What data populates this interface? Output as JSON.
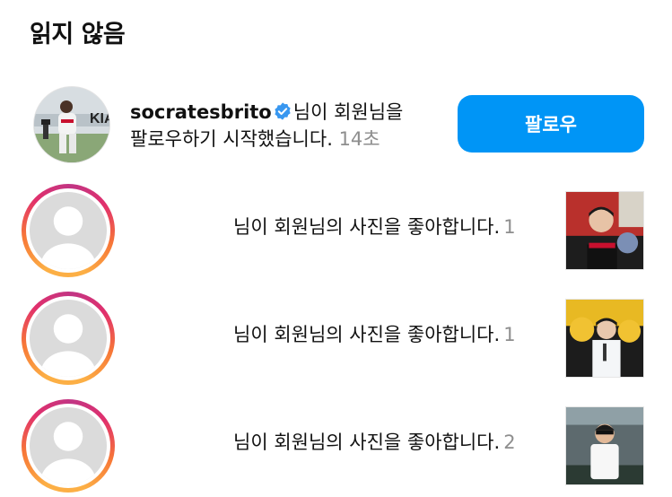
{
  "header": {
    "title": "읽지 않음"
  },
  "follow_notification": {
    "username": "socratesbrito",
    "verified_icon": "verified-badge-icon",
    "message_line1": "님이 회원님을",
    "message_line2": "팔로우하기 시작했습니다.",
    "time": "14초",
    "button_label": "팔로우",
    "button_color": "#0095f6"
  },
  "like_notifications": [
    {
      "message": "님이 회원님의 사진을 좋아합니다.",
      "time": "1"
    },
    {
      "message": "님이 회원님의 사진을 좋아합니다.",
      "time": "1"
    },
    {
      "message": "님이 회원님의 사진을 좋아합니다.",
      "time": "2"
    }
  ],
  "colors": {
    "accent": "#0095f6",
    "muted_text": "#8e8e8e",
    "story_ring": [
      "#fcaf45",
      "#f77737",
      "#e1306c",
      "#c13584"
    ]
  }
}
